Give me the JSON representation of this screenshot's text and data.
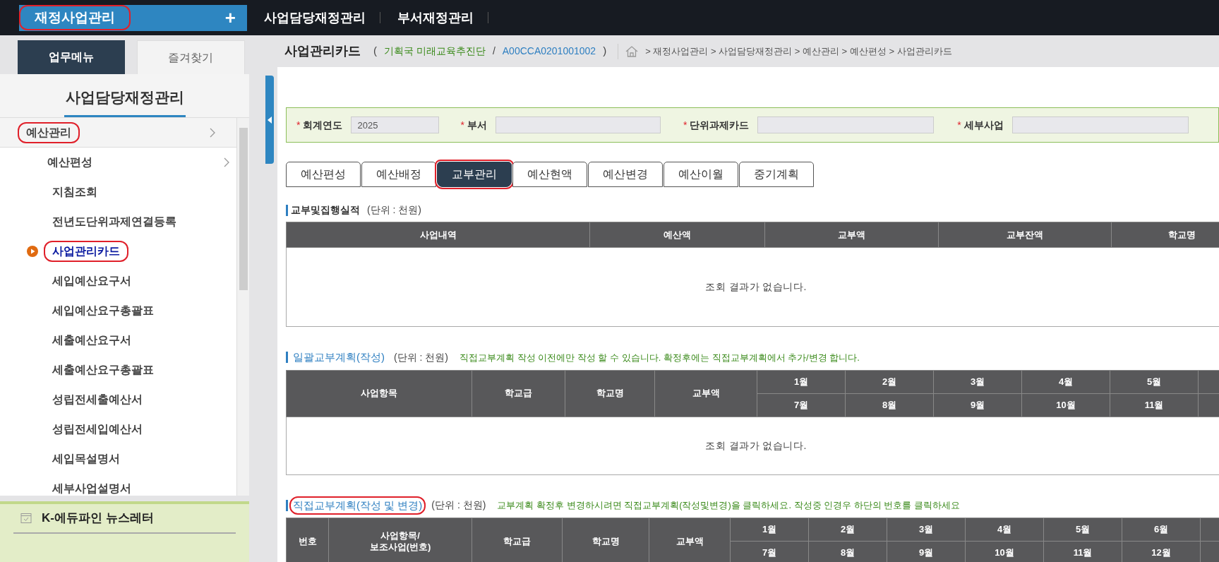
{
  "top_bar": {
    "app_button": {
      "label": "재정사업관리",
      "icon": "+",
      "circled": true
    },
    "menu": [
      {
        "label": "사업담당재정관리"
      },
      {
        "label": "부서재정관리"
      }
    ]
  },
  "sidebar": {
    "tabs": [
      {
        "label": "업무메뉴",
        "selected": true
      },
      {
        "label": "즐겨찾기",
        "selected": false
      }
    ],
    "title": "사업담당재정관리",
    "items": [
      {
        "label": "예산관리",
        "circled": true,
        "selected": false,
        "children": [
          {
            "label": "예산편성",
            "circled": false,
            "selected": false,
            "children": [
              {
                "label": "지침조회",
                "circled": false,
                "selected": false
              },
              {
                "label": "전년도단위과제연결등록",
                "circled": false,
                "selected": false
              },
              {
                "label": "사업관리카드",
                "circled": true,
                "selected": true
              },
              {
                "label": "세입예산요구서",
                "circled": false,
                "selected": false
              },
              {
                "label": "세입예산요구총괄표",
                "circled": false,
                "selected": false
              },
              {
                "label": "세출예산요구서",
                "circled": false,
                "selected": false
              },
              {
                "label": "세출예산요구총괄표",
                "circled": false,
                "selected": false
              },
              {
                "label": "성립전세출예산서",
                "circled": false,
                "selected": false
              },
              {
                "label": "성립전세입예산서",
                "circled": false,
                "selected": false
              },
              {
                "label": "세입목설명서",
                "circled": false,
                "selected": false
              },
              {
                "label": "세부사업설명서",
                "circled": false,
                "selected": false
              }
            ]
          }
        ]
      }
    ],
    "bottom_panel": {
      "items": [
        {
          "label": "K-에듀파인 뉴스레터"
        }
      ]
    }
  },
  "page_header": {
    "title": "사업관리카드",
    "open_paren": "(",
    "department": "기획국 미래교육추진단",
    "slash": "/",
    "code": "A00CCA0201001002",
    "close_paren": ")",
    "breadcrumb": "> 재정사업관리 > 사업담당재정관리 > 예산관리 > 예산편성 > 사업관리카드"
  },
  "search_form": {
    "fields": [
      {
        "required_mark": "*",
        "label": "회계연도",
        "value": "2025"
      },
      {
        "required_mark": "*",
        "label": "부서"
      },
      {
        "required_mark": "*",
        "label": "단위과제카드"
      },
      {
        "required_mark": "*",
        "label": "세부사업"
      }
    ]
  },
  "tabs": [
    {
      "label": "예산편성",
      "selected": false,
      "circled": false
    },
    {
      "label": "예산배정",
      "selected": false,
      "circled": false
    },
    {
      "label": "교부관리",
      "selected": true,
      "circled": true
    },
    {
      "label": "예산현액",
      "selected": false,
      "circled": false
    },
    {
      "label": "예산변경",
      "selected": false,
      "circled": false
    },
    {
      "label": "예산이월",
      "selected": false,
      "circled": false
    },
    {
      "label": "중기계획",
      "selected": false,
      "circled": false
    }
  ],
  "sections": [
    {
      "kind": "plain",
      "title": "교부및집행실적",
      "circled": false,
      "unit": "(단위 : 천원)",
      "columns": [
        "사업내역",
        "예산액",
        "교부액",
        "교부잔액",
        "학교명"
      ],
      "empty_message": "조회 결과가 없습니다."
    },
    {
      "kind": "link",
      "title": "일괄교부계획(작성)",
      "circled": false,
      "unit": "(단위 : 천원)",
      "note": "직접교부계획 작성 이전에만 작성 할 수 있습니다. 확정후에는 직접교부계획에서 추가/변경 합니다.",
      "columns": [
        "사업항목",
        "학교급",
        "학교명",
        "교부액"
      ],
      "month_rows": [
        [
          "1월",
          "2월",
          "3월",
          "4월",
          "5월"
        ],
        [
          "7월",
          "8월",
          "9월",
          "10월",
          "11월"
        ]
      ],
      "empty_message": "조회 결과가 없습니다."
    },
    {
      "kind": "link",
      "title": "직접교부계획(작성 및 변경)",
      "circled": true,
      "unit": "(단위 : 천원)",
      "note": "교부계획 확정후 변경하시려면 직접교부계획(작성및변경)을 클릭하세요. 작성중 인경우 하단의 번호를 클릭하세요",
      "columns": [
        "번호",
        "사업항목/\n보조사업(번호)",
        "학교급",
        "학교명",
        "교부액"
      ],
      "month_rows": [
        [
          "1월",
          "2월",
          "3월",
          "4월",
          "5월",
          "6월"
        ],
        [
          "7월",
          "8월",
          "9월",
          "10월",
          "11월",
          "12월"
        ]
      ]
    }
  ]
}
